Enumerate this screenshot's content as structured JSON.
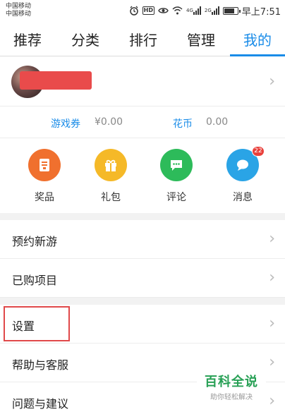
{
  "status_bar": {
    "carrier_1": "中国移动",
    "carrier_2": "中国移动",
    "hd_label": "HD",
    "net_tag_1": "4G",
    "net_tag_2": "2G",
    "time": "早上7:51"
  },
  "tabs": [
    {
      "label": "推荐"
    },
    {
      "label": "分类"
    },
    {
      "label": "排行"
    },
    {
      "label": "管理"
    },
    {
      "label": "我的"
    }
  ],
  "active_tab": "我的",
  "profile": {
    "avatar_icon": "avatar-image",
    "name_redacted": true
  },
  "balances": [
    {
      "label": "游戏券",
      "value": "¥0.00"
    },
    {
      "label": "花币",
      "value": "0.00"
    }
  ],
  "shortcuts": [
    {
      "label": "奖品",
      "icon": "prize-icon",
      "color": "#f0702e"
    },
    {
      "label": "礼包",
      "icon": "gift-icon",
      "color": "#f5b928"
    },
    {
      "label": "评论",
      "icon": "comment-icon",
      "color": "#2dbb5a"
    },
    {
      "label": "消息",
      "icon": "message-icon",
      "color": "#2aa4e6",
      "badge": "22"
    }
  ],
  "menu": [
    {
      "label": "预约新游"
    },
    {
      "label": "已购项目"
    },
    {
      "label": "设置"
    },
    {
      "label": "帮助与客服"
    },
    {
      "label": "问题与建议"
    }
  ],
  "watermark": {
    "title": "百科全说",
    "subtitle": "助你轻松解决"
  },
  "colors": {
    "accent": "#1a8ce8",
    "highlight": "#e0494a"
  }
}
